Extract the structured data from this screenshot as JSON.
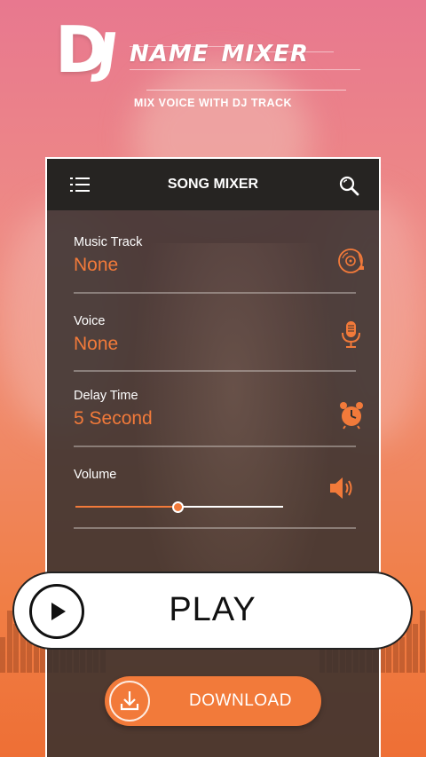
{
  "app": {
    "logo_letters": "DJ",
    "logo_word1": "NAME",
    "logo_word2": "MIXER",
    "tagline": "MIX VOICE WITH DJ TRACK"
  },
  "topbar": {
    "title": "SONG MIXER",
    "menu_icon": "menu-icon",
    "search_icon": "search-icon"
  },
  "fields": {
    "music_track": {
      "label": "Music Track",
      "value": "None",
      "icon": "vinyl-record-icon"
    },
    "voice": {
      "label": "Voice",
      "value": "None",
      "icon": "microphone-icon"
    },
    "delay_time": {
      "label": "Delay Time",
      "value": "5 Second",
      "icon": "alarm-clock-icon"
    },
    "volume": {
      "label": "Volume",
      "level": 0.49,
      "icon": "speaker-icon"
    }
  },
  "actions": {
    "play_label": "PLAY",
    "download_label": "DOWNLOAD"
  },
  "colors": {
    "accent": "#f27a3a",
    "card_bg": "#34302e",
    "topbar_bg": "#262422"
  }
}
